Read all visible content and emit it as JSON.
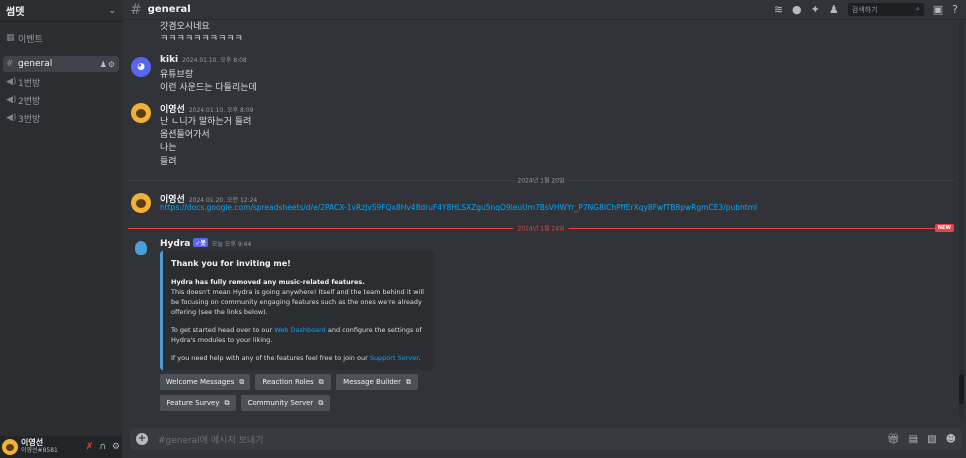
{
  "server": {
    "name": "썸뎃"
  },
  "sidebar": {
    "event_label": "이벤트",
    "channels": [
      {
        "name": "general",
        "type": "text"
      },
      {
        "name": "1번방",
        "type": "voice"
      },
      {
        "name": "2번방",
        "type": "voice"
      },
      {
        "name": "3번방",
        "type": "voice"
      }
    ]
  },
  "user": {
    "name": "이영선",
    "tag": "이영선#8581"
  },
  "header": {
    "channel": "general",
    "search_placeholder": "검색하기"
  },
  "messages": {
    "partial_lines": [
      "갓겸오시네요",
      "ㅋㅋㅋㅋㅋㅋㅋㅋㅋㅋ"
    ],
    "m1": {
      "author": "kiki",
      "time": "2024.01.10. 오후 8:08",
      "lines": [
        "유튜브랑",
        "이런 사운드는 다들리는데"
      ]
    },
    "m2": {
      "author": "이영선",
      "time": "2024.01.10. 오후 8:09",
      "lines": [
        "난 ㄴ니가 말하는거 들려",
        "옵션들어가서",
        "나는",
        "들려"
      ]
    },
    "divider1": "2024년 1월 20일",
    "m3": {
      "author": "이영선",
      "time": "2024.01.20. 오전 12:24",
      "link": "https://docs.google.com/spreadsheets/d/e/2PACX-1vRzJv59FQx8Hv48druF4Y8HLSXZgu5nqO9leuUm7BsVHWYr_P7NG8IChPffErXqy8FwfTB8pwRgmCE3/pubhtml"
    },
    "divider2": "2024년 1월 24일",
    "new_badge": "NEW",
    "m4": {
      "author": "Hydra",
      "badge": "✓봇",
      "time": "오늘 오후 9:44",
      "embed": {
        "title": "Thank you for inviting me!",
        "p1_bold": "Hydra has fully removed any music-related features.",
        "p1_rest": "This doesn't mean Hydra is going anywhere! Itself and the team behind it will be focusing on community engaging features such as the ones we're already offering (see the links below).",
        "p2_a": "To get started head over to our ",
        "p2_link": "Web Dashboard",
        "p2_b": " and configure the settings of Hydra's modules to your liking.",
        "p3_a": "If you need help with any of the features feel free to join our ",
        "p3_link": "Support Server",
        "p3_b": "."
      },
      "buttons": [
        "Welcome Messages",
        "Reaction Roles",
        "Message Builder",
        "Feature Survey",
        "Community Server"
      ]
    }
  },
  "composer": {
    "placeholder": "#general에 메시지 보내기"
  },
  "colors": {
    "accent": "#5865f2",
    "link": "#00a8fc",
    "new": "#f23f43",
    "embed_bar": "#4a9fd8"
  }
}
